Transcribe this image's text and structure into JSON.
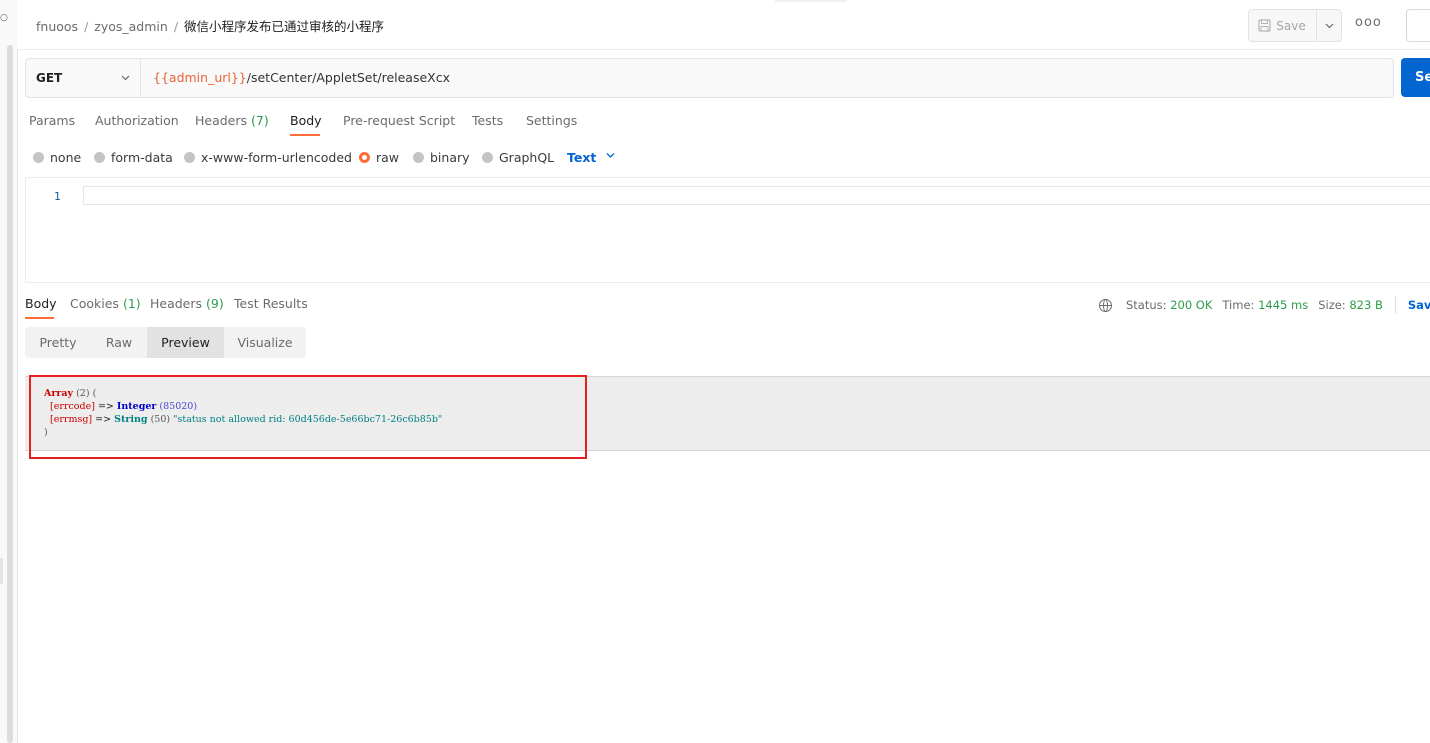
{
  "header": {
    "breadcrumb": [
      "fnuoos",
      "zyos_admin",
      "微信小程序发布已通过审核的小程序"
    ],
    "separator": "/",
    "save_label": "Save",
    "more_label": "ooo"
  },
  "request": {
    "method": "GET",
    "url_var": "{{admin_url}}",
    "url_path": "/setCenter/AppletSet/releaseXcx",
    "send_label": "Se",
    "tabs": [
      {
        "label": "Params",
        "count": ""
      },
      {
        "label": "Authorization",
        "count": ""
      },
      {
        "label": "Headers",
        "count": "(7)"
      },
      {
        "label": "Body",
        "count": ""
      },
      {
        "label": "Pre-request Script",
        "count": ""
      },
      {
        "label": "Tests",
        "count": ""
      },
      {
        "label": "Settings",
        "count": ""
      }
    ],
    "active_tab": "Body",
    "body_types": [
      "none",
      "form-data",
      "x-www-form-urlencoded",
      "raw",
      "binary",
      "GraphQL"
    ],
    "selected_body_type": "raw",
    "raw_format": "Text",
    "editor_line": "1"
  },
  "response": {
    "tabs": [
      {
        "label": "Body",
        "count": ""
      },
      {
        "label": "Cookies",
        "count": "(1)"
      },
      {
        "label": "Headers",
        "count": "(9)"
      },
      {
        "label": "Test Results",
        "count": ""
      }
    ],
    "active_tab": "Body",
    "status_label": "Status:",
    "status_value": "200 OK",
    "time_label": "Time:",
    "time_value": "1445 ms",
    "size_label": "Size:",
    "size_value": "823 B",
    "save_response_label": "Save R",
    "view_modes": [
      "Pretty",
      "Raw",
      "Preview",
      "Visualize"
    ],
    "active_view": "Preview",
    "preview": {
      "array_label": "Array",
      "array_count": "(2)",
      "open": "(",
      "key1": "[errcode]",
      "arrow": "=>",
      "type1": "Integer",
      "val1": "(85020)",
      "key2": "[errmsg]",
      "type2": "String",
      "len2": "(50)",
      "val2": "\"status not allowed rid: 60d456de-5e66bc71-26c6b85b\"",
      "close": ")"
    }
  },
  "colors": {
    "accent": "#ff6c37",
    "send_blue": "#0265d2",
    "status_green": "#2a9d4b",
    "highlight_red": "#e81f1f"
  }
}
